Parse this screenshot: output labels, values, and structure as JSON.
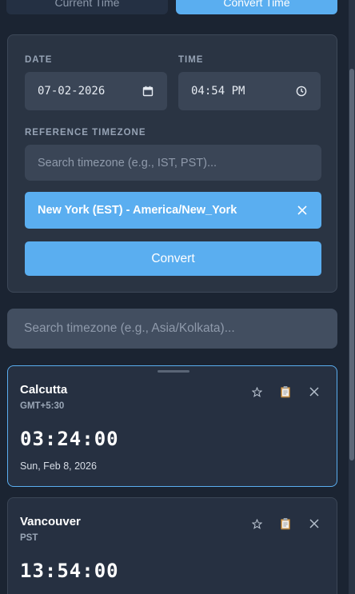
{
  "tabs": [
    {
      "label": "Current Time",
      "active": false
    },
    {
      "label": "Convert Time",
      "active": true
    }
  ],
  "converter": {
    "date_label": "DATE",
    "date_value": "07-02-2026",
    "time_label": "TIME",
    "time_value": "04:54 PM",
    "ref_label": "REFERENCE TIMEZONE",
    "ref_placeholder": "Search timezone (e.g., IST, PST)...",
    "selected_timezone": "New York (EST) - America/New_York",
    "convert_label": "Convert"
  },
  "results": {
    "search_placeholder": "Search timezone (e.g., Asia/Kolkata)...",
    "cards": [
      {
        "city": "Calcutta",
        "offset": "GMT+5:30",
        "time": "03:24:00",
        "date": "Sun, Feb 8, 2026"
      },
      {
        "city": "Vancouver",
        "offset": "PST",
        "time": "13:54:00",
        "date": ""
      }
    ]
  },
  "icons": {
    "calendar": "calendar-icon",
    "clock": "clock-icon",
    "close": "close-icon",
    "star": "star-icon",
    "copy": "clipboard-icon"
  },
  "colors": {
    "accent": "#5aaef0",
    "background": "#1b2432",
    "panel": "#2a3443"
  }
}
